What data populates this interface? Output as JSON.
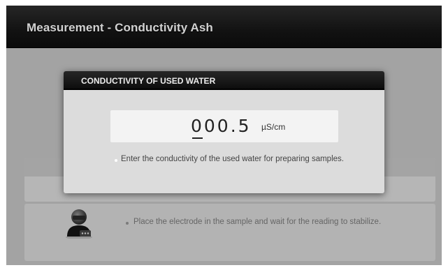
{
  "app": {
    "title": "Measurement - Conductivity Ash"
  },
  "dialog": {
    "title": "CONDUCTIVITY OF USED WATER",
    "value": "000.5",
    "unit": "µS/cm",
    "hint": "Enter the conductivity of the used water for preparing samples."
  },
  "instruction": {
    "text": "Place the electrode in the sample and wait for the reading to stabilize.",
    "icon": "operator-icon"
  }
}
